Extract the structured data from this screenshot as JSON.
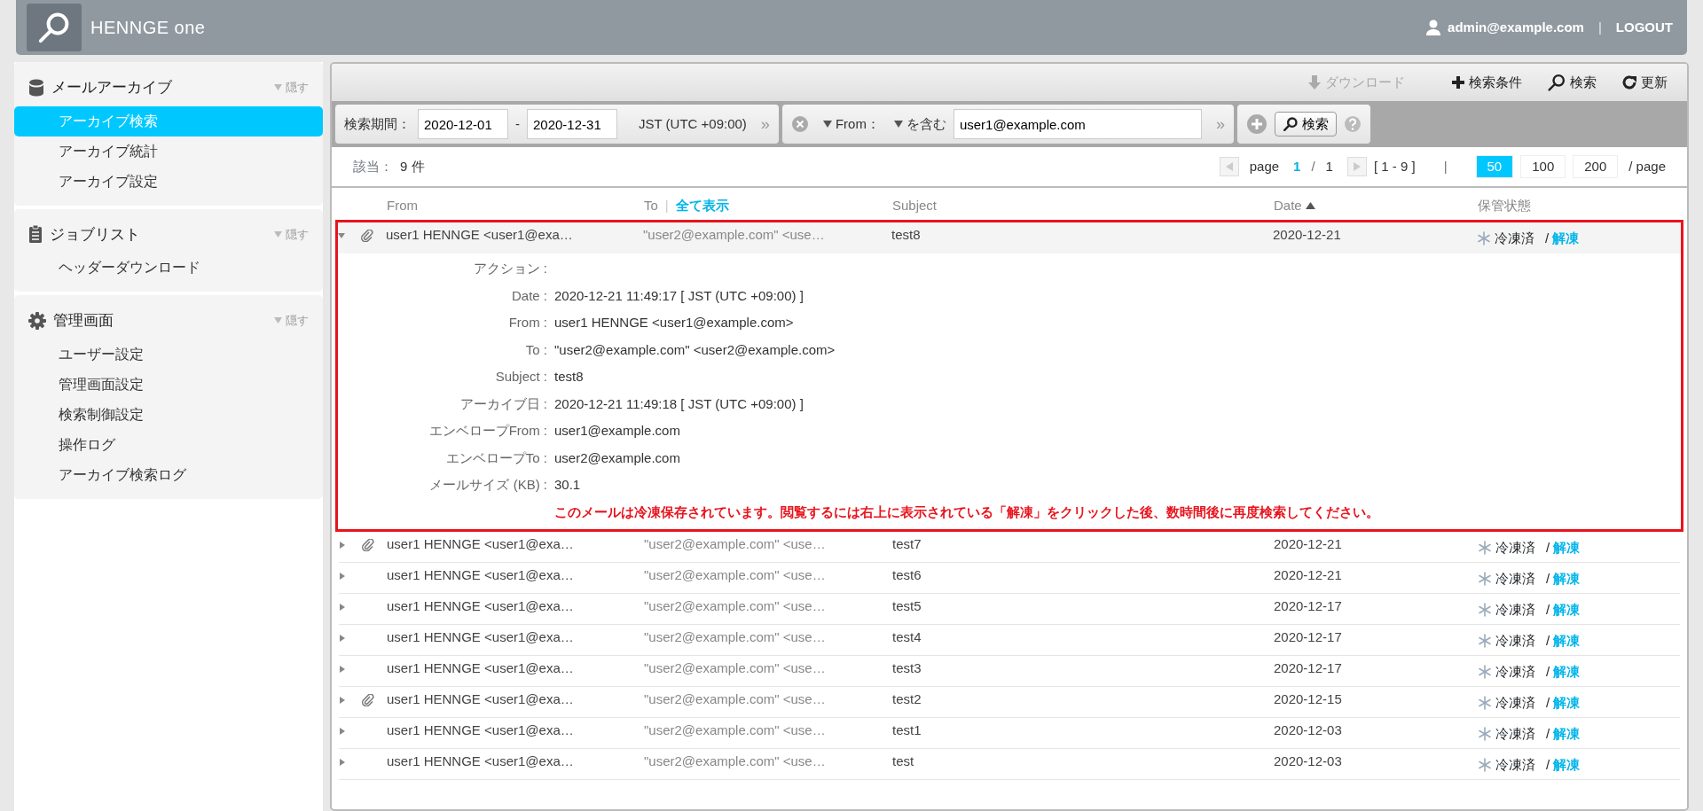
{
  "header": {
    "brand": "HENNGE one",
    "user": "admin@example.com",
    "separator": "|",
    "logout": "LOGOUT"
  },
  "sidebar": {
    "sections": [
      {
        "kind": "database",
        "title": "メールアーカイブ",
        "hide": "隠す",
        "items": [
          {
            "label": "アーカイブ検索",
            "selected": true
          },
          {
            "label": "アーカイブ統計",
            "selected": false
          },
          {
            "label": "アーカイブ設定",
            "selected": false
          }
        ]
      },
      {
        "kind": "clipboard",
        "title": "ジョブリスト",
        "hide": "隠す",
        "items": [
          {
            "label": "ヘッダーダウンロード",
            "selected": false
          }
        ]
      },
      {
        "kind": "gear",
        "title": "管理画面",
        "hide": "隠す",
        "items": [
          {
            "label": "ユーザー設定",
            "selected": false
          },
          {
            "label": "管理画面設定",
            "selected": false
          },
          {
            "label": "検索制御設定",
            "selected": false
          },
          {
            "label": "操作ログ",
            "selected": false
          },
          {
            "label": "アーカイブ検索ログ",
            "selected": false
          }
        ]
      }
    ]
  },
  "toolbar": {
    "buttons": [
      {
        "kind": "download",
        "label": "ダウンロード",
        "disabled": true
      },
      {
        "kind": "plus",
        "label": "検索条件",
        "disabled": false
      },
      {
        "kind": "search",
        "label": "検索",
        "disabled": false
      },
      {
        "kind": "refresh",
        "label": "更新",
        "disabled": false
      }
    ]
  },
  "filters": {
    "period_label": "検索期間：",
    "date_from": "2020-12-01",
    "range_separator": "-",
    "date_to": "2020-12-31",
    "timezone": "JST (UTC +09:00)",
    "period_more": "»",
    "condition": {
      "field": "From：",
      "operator": "を含む",
      "value": "user1@example.com",
      "more": "»"
    },
    "search_button": "検索"
  },
  "results": {
    "label": "該当：",
    "count": "9 件",
    "pagination": {
      "page_label": "page",
      "current": "1",
      "slash": "/",
      "total": "1",
      "range": "[ 1 - 9 ]",
      "divider": "|",
      "per_page": [
        {
          "label": "50",
          "selected": true
        },
        {
          "label": "100",
          "selected": false
        },
        {
          "label": "200",
          "selected": false
        }
      ],
      "per_page_suffix": "/ page"
    }
  },
  "table": {
    "columns": {
      "from": "From",
      "to": "To",
      "to_divider": "|",
      "show_all": "全て表示",
      "subject": "Subject",
      "date": "Date",
      "date_sort_ascending": true,
      "status": "保管状態"
    },
    "rows": [
      {
        "expanded": true,
        "attachment": true,
        "from": "user1 HENNGE <user1@exa…",
        "to": "\"user2@example.com\" <use…",
        "subject": "test8",
        "date": "2020-12-21",
        "status": "冷凍済",
        "status_separator": "/",
        "action": "解凍",
        "details": [
          {
            "label": "アクション :"
          },
          {
            "label": "Date :",
            "value": "2020-12-21 11:49:17 [ JST (UTC +09:00) ]"
          },
          {
            "label": "From :",
            "value": "user1 HENNGE <user1@example.com>"
          },
          {
            "label": "To :",
            "value": "\"user2@example.com\" <user2@example.com>"
          },
          {
            "label": "Subject :",
            "value": "test8"
          },
          {
            "label": "アーカイブ日 :",
            "value": "2020-12-21 11:49:18 [ JST (UTC +09:00) ]"
          },
          {
            "label": "エンベロープFrom :",
            "value": "user1@example.com"
          },
          {
            "label": "エンベロープTo :",
            "value": "user2@example.com"
          },
          {
            "label": "メールサイズ (KB) :",
            "value": "30.1"
          }
        ],
        "notice": "このメールは冷凍保存されています。閲覧するには右上に表示されている「解凍」をクリックした後、数時間後に再度検索してください。"
      },
      {
        "expanded": false,
        "attachment": true,
        "from": "user1 HENNGE <user1@exa…",
        "to": "\"user2@example.com\" <use…",
        "subject": "test7",
        "date": "2020-12-21",
        "status": "冷凍済",
        "status_separator": "/",
        "action": "解凍"
      },
      {
        "expanded": false,
        "attachment": false,
        "from": "user1 HENNGE <user1@exa…",
        "to": "\"user2@example.com\" <use…",
        "subject": "test6",
        "date": "2020-12-21",
        "status": "冷凍済",
        "status_separator": "/",
        "action": "解凍"
      },
      {
        "expanded": false,
        "attachment": false,
        "from": "user1 HENNGE <user1@exa…",
        "to": "\"user2@example.com\" <use…",
        "subject": "test5",
        "date": "2020-12-17",
        "status": "冷凍済",
        "status_separator": "/",
        "action": "解凍"
      },
      {
        "expanded": false,
        "attachment": false,
        "from": "user1 HENNGE <user1@exa…",
        "to": "\"user2@example.com\" <use…",
        "subject": "test4",
        "date": "2020-12-17",
        "status": "冷凍済",
        "status_separator": "/",
        "action": "解凍"
      },
      {
        "expanded": false,
        "attachment": false,
        "from": "user1 HENNGE <user1@exa…",
        "to": "\"user2@example.com\" <use…",
        "subject": "test3",
        "date": "2020-12-17",
        "status": "冷凍済",
        "status_separator": "/",
        "action": "解凍"
      },
      {
        "expanded": false,
        "attachment": true,
        "from": "user1 HENNGE <user1@exa…",
        "to": "\"user2@example.com\" <use…",
        "subject": "test2",
        "date": "2020-12-15",
        "status": "冷凍済",
        "status_separator": "/",
        "action": "解凍"
      },
      {
        "expanded": false,
        "attachment": false,
        "from": "user1 HENNGE <user1@exa…",
        "to": "\"user2@example.com\" <use…",
        "subject": "test1",
        "date": "2020-12-03",
        "status": "冷凍済",
        "status_separator": "/",
        "action": "解凍"
      },
      {
        "expanded": false,
        "attachment": false,
        "from": "user1 HENNGE <user1@exa…",
        "to": "\"user2@example.com\" <use…",
        "subject": "test",
        "date": "2020-12-03",
        "status": "冷凍済",
        "status_separator": "/",
        "action": "解凍"
      }
    ]
  }
}
